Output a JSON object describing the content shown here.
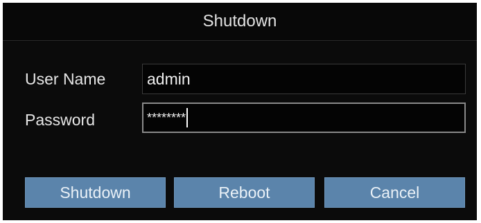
{
  "dialog": {
    "title": "Shutdown"
  },
  "form": {
    "username_label": "User Name",
    "username_value": "admin",
    "password_label": "Password",
    "password_value": "********"
  },
  "buttons": {
    "shutdown": "Shutdown",
    "reboot": "Reboot",
    "cancel": "Cancel"
  },
  "colors": {
    "button_bg": "#5b84ab",
    "dialog_bg": "#000000",
    "text": "#e6e6e6"
  }
}
